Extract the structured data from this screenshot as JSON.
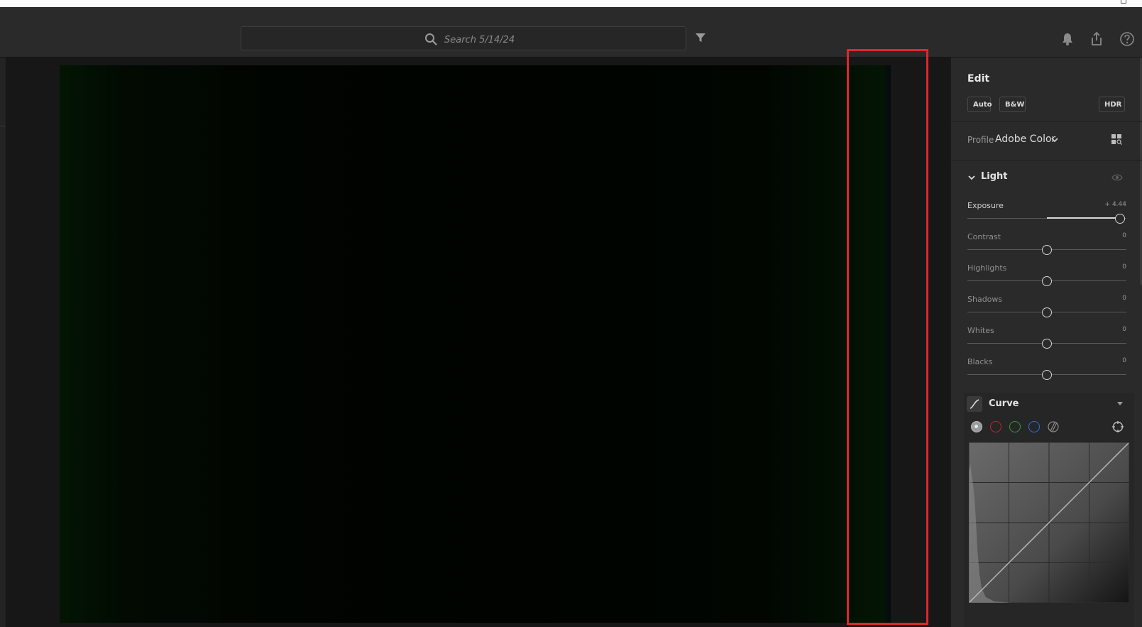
{
  "search": {
    "placeholder": "Search 5/14/24"
  },
  "toolbar": {
    "filter_icon": "funnel-icon",
    "notifications_icon": "bell-icon",
    "share_icon": "share-icon",
    "help_icon": "question-circle-icon"
  },
  "edit_panel": {
    "title": "Edit",
    "auto_label": "Auto",
    "bw_label": "B&W",
    "hdr_label": "HDR",
    "profile": {
      "label": "Profile",
      "value": "Adobe Color"
    },
    "light": {
      "title": "Light",
      "sliders": [
        {
          "name": "Exposure",
          "value": "+ 4.44",
          "level": 0.96,
          "active": true
        },
        {
          "name": "Contrast",
          "value": "0",
          "level": 0.5,
          "active": false
        },
        {
          "name": "Highlights",
          "value": "0",
          "level": 0.5,
          "active": false
        },
        {
          "name": "Shadows",
          "value": "0",
          "level": 0.5,
          "active": false
        },
        {
          "name": "Whites",
          "value": "0",
          "level": 0.5,
          "active": false
        },
        {
          "name": "Blacks",
          "value": "0",
          "level": 0.5,
          "active": false
        }
      ]
    },
    "curve": {
      "title": "Curve",
      "channels": [
        "point-white",
        "red",
        "green",
        "blue",
        "parametric"
      ]
    }
  },
  "colors": {
    "accent_highlight": "#e0262b",
    "panel_bg": "#2a2a2a"
  }
}
